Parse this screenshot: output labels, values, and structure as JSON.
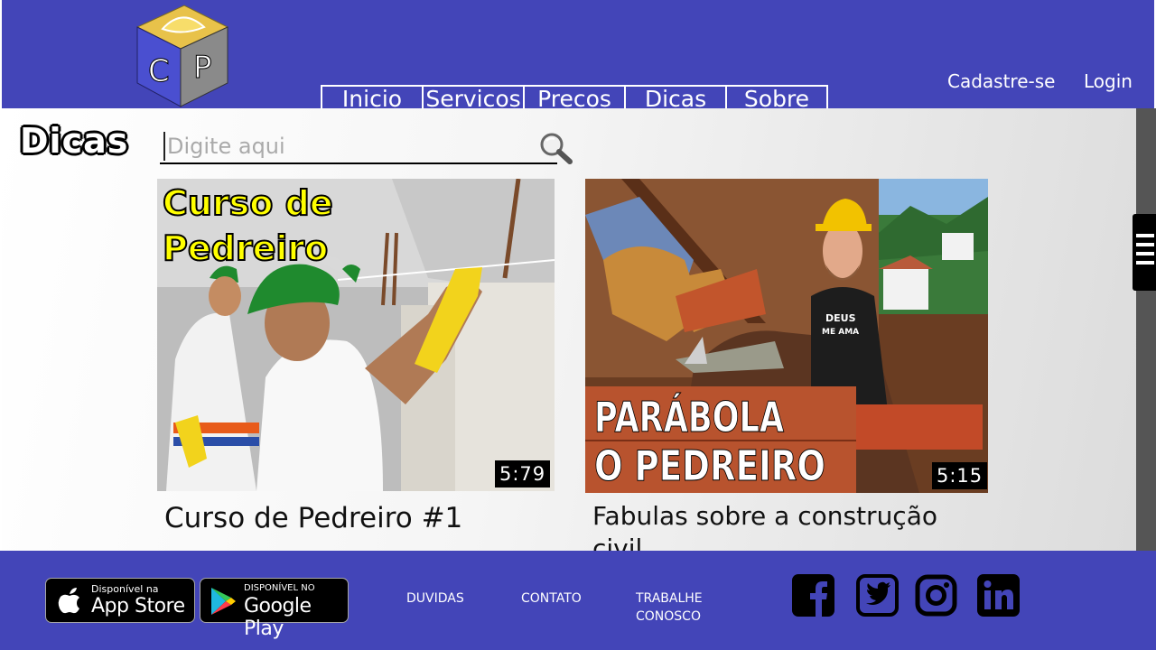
{
  "header": {
    "logo_letters": [
      "C",
      "P"
    ],
    "nav": [
      "Inicio",
      "Servicos",
      "Precos",
      "Dicas",
      "Sobre"
    ],
    "signup_label": "Cadastre-se",
    "login_label": "Login"
  },
  "main": {
    "page_title": "Dicas",
    "search": {
      "placeholder": "Digite aqui",
      "value": ""
    },
    "videos": [
      {
        "thumbnail_text": [
          "Curso de",
          "Pedreiro"
        ],
        "duration": "5:79",
        "title": "Curso de Pedreiro #1"
      },
      {
        "thumbnail_text": [
          "PARÁBOLA",
          "O PEDREIRO"
        ],
        "shirt_text": [
          "DEUS",
          "ME AMA"
        ],
        "duration": "5:15",
        "title": "Fabulas sobre a construção civil"
      }
    ]
  },
  "footer": {
    "app_store": {
      "small": "Disponível na",
      "big": "App Store"
    },
    "google_play": {
      "small": "DISPONÍVEL NO",
      "big": "Google Play"
    },
    "links": [
      "DUVIDAS",
      "CONTATO",
      "TRABALHE CONOSCO"
    ],
    "social": [
      "facebook-icon",
      "twitter-icon",
      "instagram-icon",
      "linkedin-icon"
    ]
  },
  "colors": {
    "brand_blue": "#4345b8",
    "thumbnail_yellow": "#ffff00",
    "helmet_yellow": "#f2c200",
    "helmet_green": "#1f8a2e"
  }
}
